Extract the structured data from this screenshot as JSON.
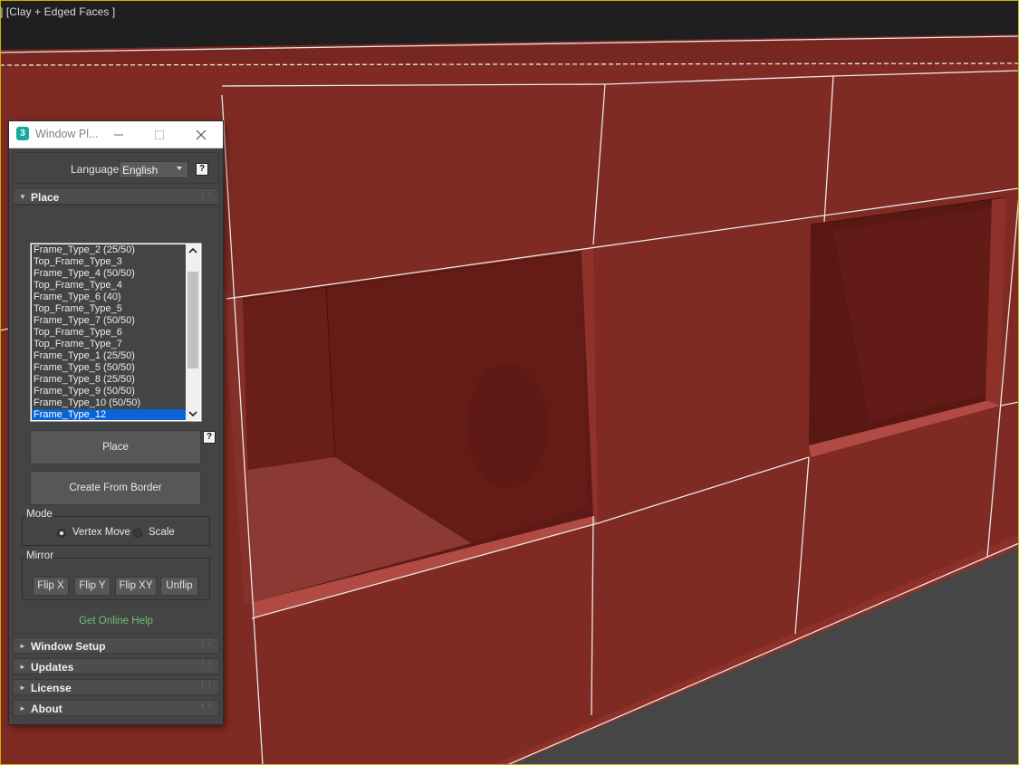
{
  "viewport": {
    "label": "] [Clay + Edged Faces ]"
  },
  "window": {
    "icon_text": "3",
    "title": "Window Pl...",
    "minimize_icon": "minimize-icon",
    "maximize_icon": "maximize-icon",
    "close_icon": "close-icon"
  },
  "language": {
    "label": "Language:",
    "selected": "English",
    "help": "?"
  },
  "rollouts": {
    "place": "Place",
    "window_setup": "Window Setup",
    "updates": "Updates",
    "license": "License",
    "about": "About"
  },
  "frame_list": {
    "items": [
      "Frame_Type_2 (25/50)",
      "Top_Frame_Type_3",
      "Frame_Type_4 (50/50)",
      "Top_Frame_Type_4",
      "Frame_Type_6 (40)",
      "Top_Frame_Type_5",
      "Frame_Type_7 (50/50)",
      "Top_Frame_Type_6",
      "Top_Frame_Type_7",
      "Frame_Type_1 (25/50)",
      "Frame_Type_5 (50/50)",
      "Frame_Type_8 (25/50)",
      "Frame_Type_9 (50/50)",
      "Frame_Type_10 (50/50)",
      "Frame_Type_12"
    ],
    "selected_index": 14,
    "help": "?"
  },
  "buttons": {
    "place": "Place",
    "create_from_border": "Create From Border"
  },
  "mode": {
    "title": "Mode",
    "vertex_move": "Vertex Move",
    "scale": "Scale",
    "selected": "vertex_move"
  },
  "mirror": {
    "title": "Mirror",
    "flip_x": "Flip X",
    "flip_y": "Flip Y",
    "flip_xy": "Flip XY",
    "unflip": "Unflip"
  },
  "help_link": "Get Online Help",
  "colors": {
    "clay": "#7d2822",
    "panel": "#444444",
    "selection": "#0a64d4",
    "link": "#72c072",
    "viewport_border": "#c8b400"
  }
}
